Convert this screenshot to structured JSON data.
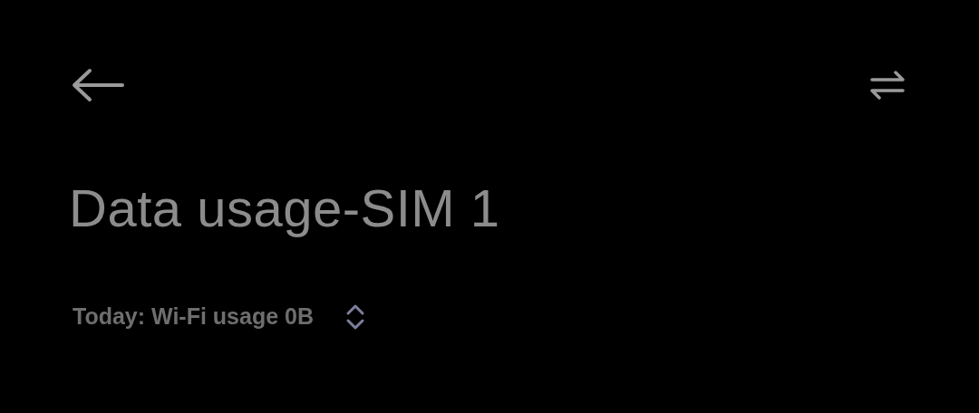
{
  "title": "Data usage-SIM 1",
  "summary": {
    "text": "Today: Wi-Fi usage 0B"
  }
}
